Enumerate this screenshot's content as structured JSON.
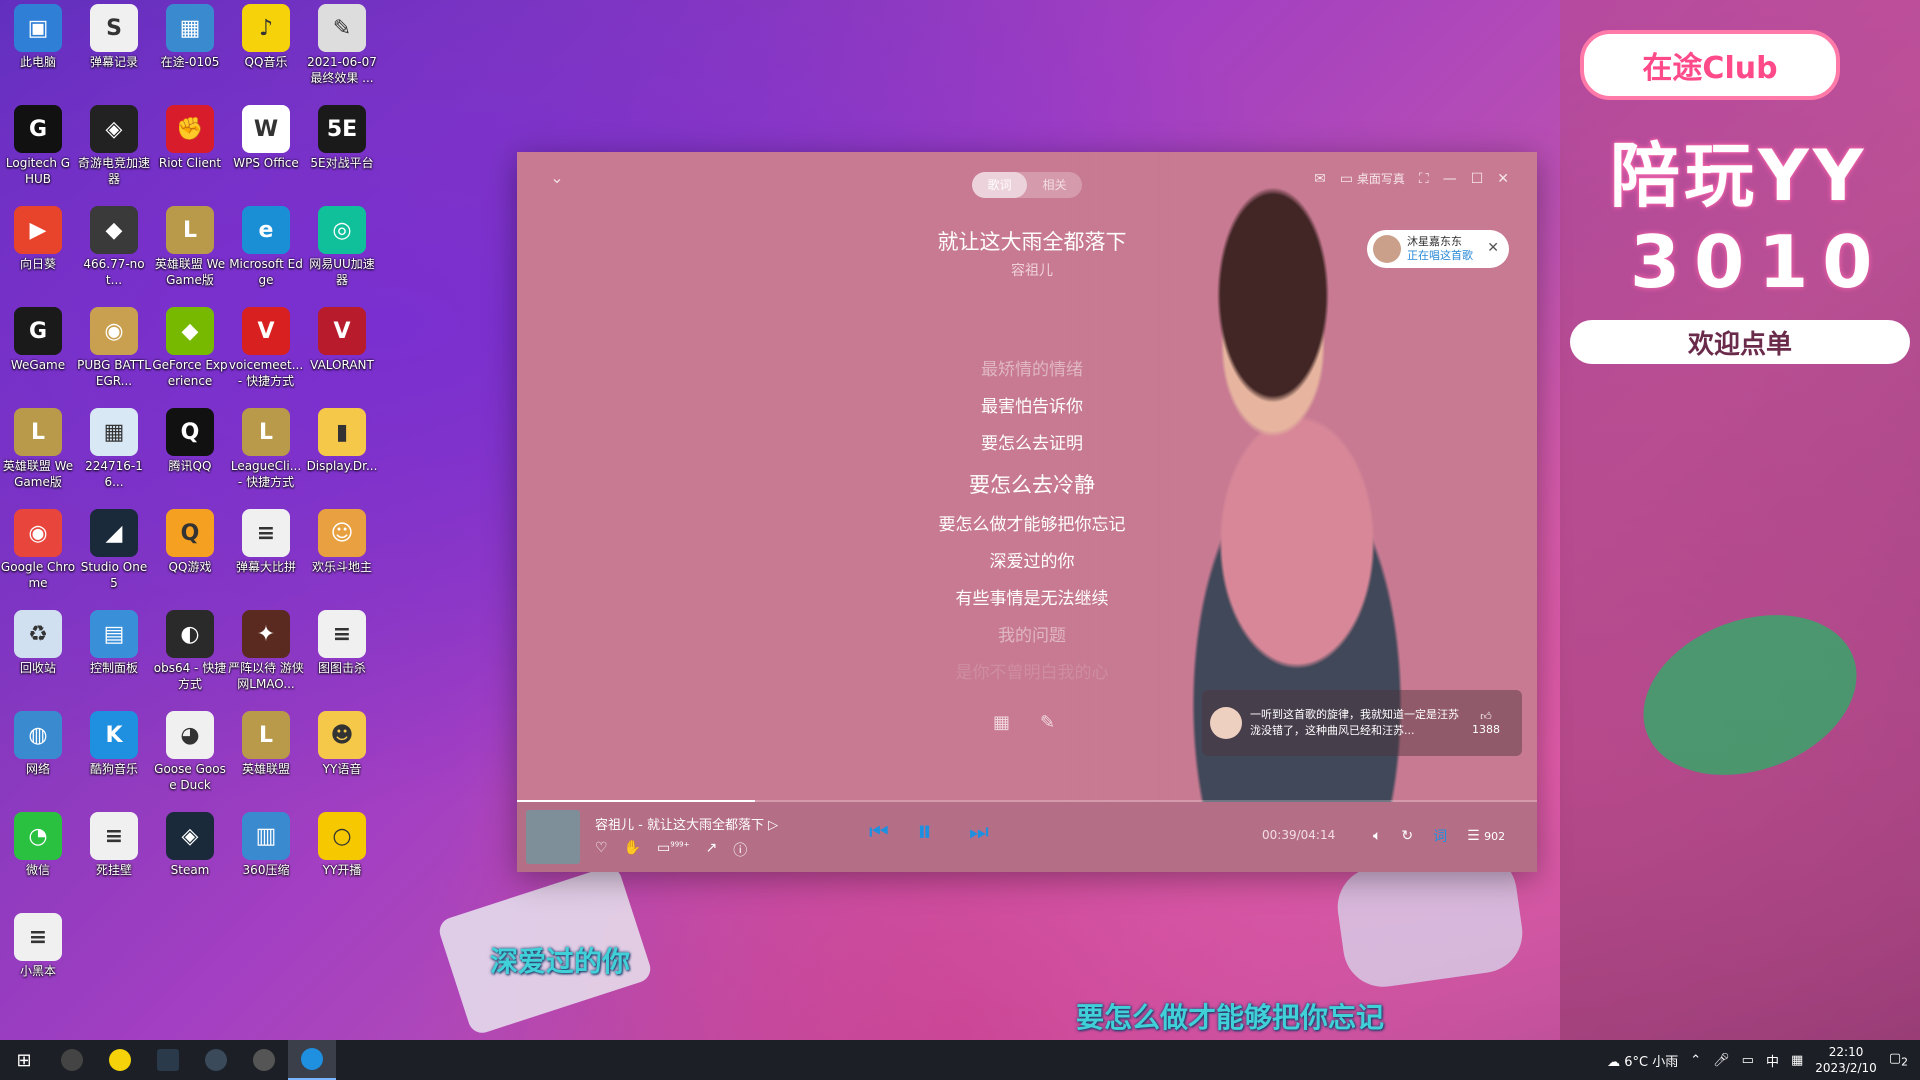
{
  "desktop_icons": [
    {
      "label": "此电脑",
      "color": "#2f7fd6",
      "glyph": "▣"
    },
    {
      "label": "弹幕记录",
      "color": "#f0f0f0",
      "glyph": "S"
    },
    {
      "label": "在途-0105",
      "color": "#3a8ad0",
      "glyph": "▦"
    },
    {
      "label": "QQ音乐",
      "color": "#f5d20a",
      "glyph": "♪"
    },
    {
      "label": "2021-06-07 最终效果 ...",
      "color": "#dddddd",
      "glyph": "✎"
    },
    {
      "label": "Logitech G HUB",
      "color": "#111111",
      "glyph": "G"
    },
    {
      "label": "奇游电竞加速器",
      "color": "#222222",
      "glyph": "◈"
    },
    {
      "label": "Riot Client",
      "color": "#d81c2c",
      "glyph": "✊"
    },
    {
      "label": "WPS Office",
      "color": "#ffffff",
      "glyph": "W"
    },
    {
      "label": "5E对战平台",
      "color": "#1a1a1a",
      "glyph": "5E"
    },
    {
      "label": "向日葵",
      "color": "#e8432b",
      "glyph": "▶"
    },
    {
      "label": "466.77-not...",
      "color": "#3a3a3a",
      "glyph": "◆"
    },
    {
      "label": "英雄联盟 WeGame版",
      "color": "#b89a4a",
      "glyph": "L"
    },
    {
      "label": "Microsoft Edge",
      "color": "#1b8fd6",
      "glyph": "e"
    },
    {
      "label": "网易UU加速器",
      "color": "#10c09a",
      "glyph": "◎"
    },
    {
      "label": "WeGame",
      "color": "#1a1a1a",
      "glyph": "G"
    },
    {
      "label": "PUBG BATTLEGR...",
      "color": "#c8a050",
      "glyph": "◉"
    },
    {
      "label": "GeForce Experience",
      "color": "#76b900",
      "glyph": "◆"
    },
    {
      "label": "voicemeet... - 快捷方式",
      "color": "#d82020",
      "glyph": "V"
    },
    {
      "label": "VALORANT",
      "color": "#b81c2c",
      "glyph": "V"
    },
    {
      "label": "英雄联盟 WeGame版",
      "color": "#b89a4a",
      "glyph": "L"
    },
    {
      "label": "224716-16...",
      "color": "#d8e8f5",
      "glyph": "▦"
    },
    {
      "label": "腾讯QQ",
      "color": "#111111",
      "glyph": "Q"
    },
    {
      "label": "LeagueCli... - 快捷方式",
      "color": "#b89a4a",
      "glyph": "L"
    },
    {
      "label": "Display.Dr...",
      "color": "#f5c84a",
      "glyph": "▮"
    },
    {
      "label": "Google Chrome",
      "color": "#e8453c",
      "glyph": "◉"
    },
    {
      "label": "Studio One 5",
      "color": "#1a2a3a",
      "glyph": "◢"
    },
    {
      "label": "QQ游戏",
      "color": "#f5a020",
      "glyph": "Q"
    },
    {
      "label": "弹幕大比拼",
      "color": "#f0f0f0",
      "glyph": "≡"
    },
    {
      "label": "欢乐斗地主",
      "color": "#e8a040",
      "glyph": "☺"
    },
    {
      "label": "回收站",
      "color": "#d0e0f0",
      "glyph": "♻"
    },
    {
      "label": "控制面板",
      "color": "#3a90d8",
      "glyph": "▤"
    },
    {
      "label": "obs64 - 快捷方式",
      "color": "#2a2a2a",
      "glyph": "◐"
    },
    {
      "label": "严阵以待 游侠网LMAO...",
      "color": "#5a2a20",
      "glyph": "✦"
    },
    {
      "label": "图图击杀",
      "color": "#f0f0f0",
      "glyph": "≡"
    },
    {
      "label": "网络",
      "color": "#3a8ad0",
      "glyph": "◍"
    },
    {
      "label": "酷狗音乐",
      "color": "#1f8fe0",
      "glyph": "K"
    },
    {
      "label": "Goose Goose Duck",
      "color": "#f0f0f0",
      "glyph": "◕"
    },
    {
      "label": "英雄联盟",
      "color": "#b89a4a",
      "glyph": "L"
    },
    {
      "label": "YY语音",
      "color": "#f5c84a",
      "glyph": "☻"
    },
    {
      "label": "微信",
      "color": "#2ac040",
      "glyph": "◔"
    },
    {
      "label": "死挂壁",
      "color": "#f0f0f0",
      "glyph": "≡"
    },
    {
      "label": "Steam",
      "color": "#1a2a3a",
      "glyph": "◈"
    },
    {
      "label": "360压缩",
      "color": "#3a8ad0",
      "glyph": "▥"
    },
    {
      "label": "YY开播",
      "color": "#f5c800",
      "glyph": "○"
    },
    {
      "label": "小黑本",
      "color": "#f0f0f0",
      "glyph": "≡"
    }
  ],
  "banner": {
    "club": "在途Club",
    "peiwan": "陪玩YY",
    "number": "3010",
    "welcome": "欢迎点单"
  },
  "player": {
    "tabs": [
      {
        "label": "歌词"
      },
      {
        "label": "相关"
      }
    ],
    "desktop_lyric_btn": "桌面写真",
    "song_title": "就让这大雨全都落下",
    "artist": "容祖儿",
    "listener": {
      "name": "沐星嘉东东",
      "status": "正在唱这首歌"
    },
    "lyrics": [
      "最矫情的情绪",
      "最害怕告诉你",
      "要怎么去证明",
      "要怎么去冷静",
      "要怎么做才能够把你忘记",
      "深爱过的你",
      "有些事情是无法继续",
      "我的问题",
      "是你不曾明白我的心"
    ],
    "comment": {
      "text": "一听到这首歌的旋律，我就知道一定是汪苏泷没错了，这种曲风已经和汪苏...",
      "likes": "1388"
    },
    "progress": 0.233,
    "now_playing": "容祖儿 - 就让这大雨全都落下",
    "badge_999": "999+",
    "time": "00:39/04:14",
    "lyric_btn": "词",
    "playlist_count": "902"
  },
  "desktop_lyrics": {
    "line1": "深爱过的你",
    "line2": "要怎么做才能够把你忘记"
  },
  "taskbar": {
    "weather": "6°C 小雨",
    "ime": "中",
    "time": "22:10",
    "date": "2023/2/10",
    "notifications": "2"
  },
  "colors": {
    "accent": "#1f8fe0",
    "player_bg": "#c77a92",
    "desktop_lyric": "#3fd0d8"
  }
}
